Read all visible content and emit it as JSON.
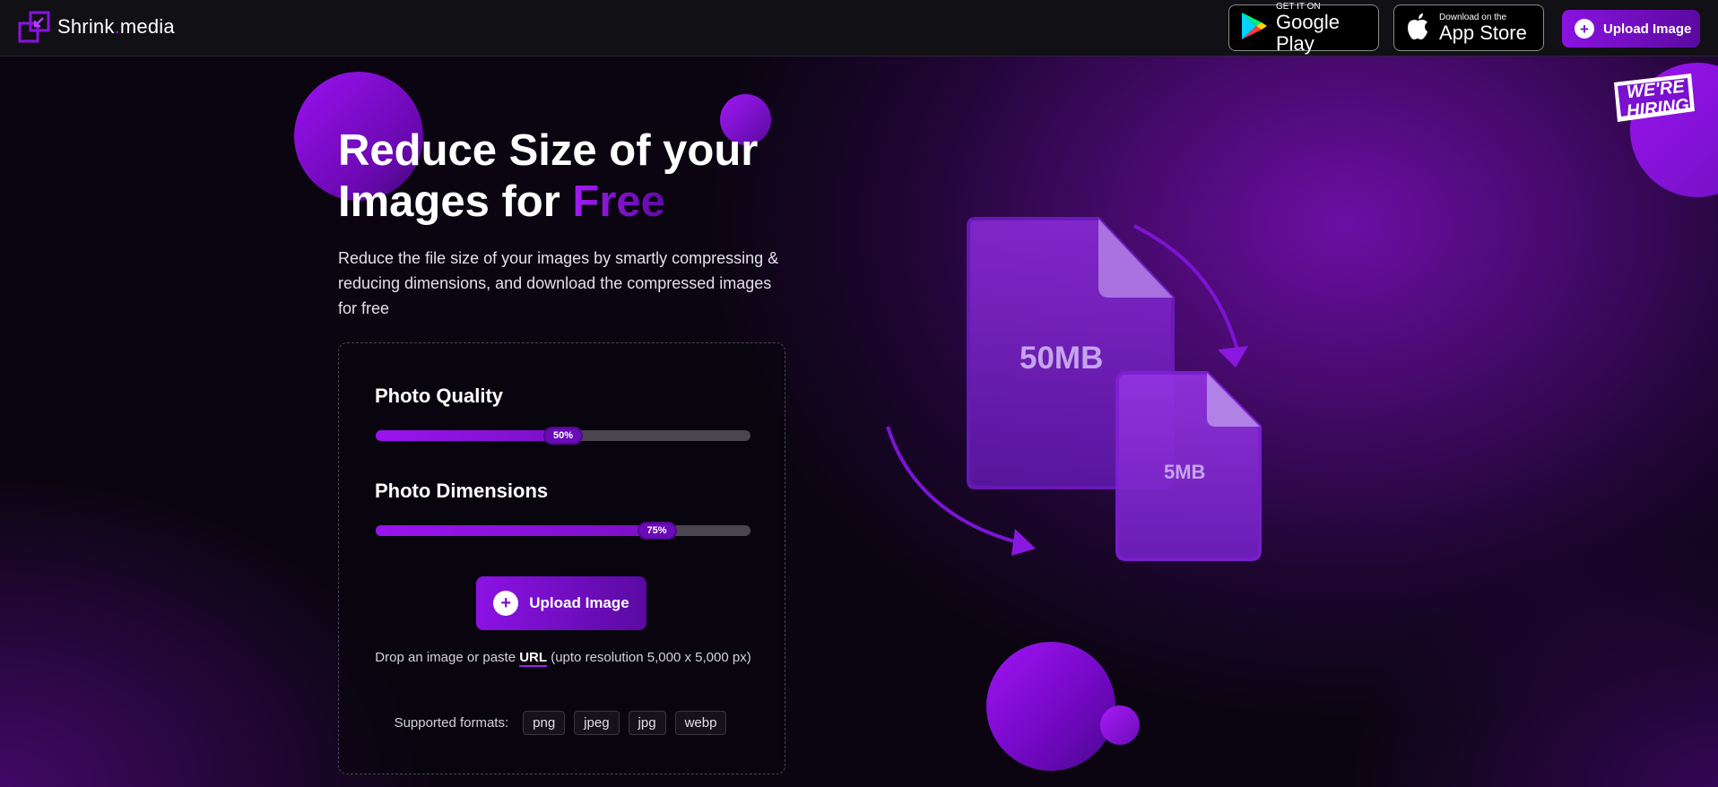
{
  "header": {
    "logo_text_a": "Shrink",
    "logo_dot": ".",
    "logo_text_b": "media",
    "google_play": {
      "small": "GET IT ON",
      "big": "Google Play"
    },
    "app_store": {
      "small": "Download on the",
      "big": "App Store"
    },
    "upload_label": "Upload Image"
  },
  "hero": {
    "title_line1": "Reduce Size of your",
    "title_line2_prefix": "Images for ",
    "title_highlight": "Free",
    "subtitle": "Reduce the file size of your images by smartly compressing & reducing dimensions, and download the compressed images for free"
  },
  "card": {
    "quality": {
      "label": "Photo Quality",
      "value_text": "50%",
      "value": 0.5
    },
    "dimensions": {
      "label": "Photo Dimensions",
      "value_text": "75%",
      "value": 0.75
    },
    "upload_label": "Upload Image",
    "drop_prefix": "Drop an image or paste ",
    "drop_url": "URL",
    "drop_suffix": " (upto resolution 5,000 x 5,000 px)",
    "formats_label": "Supported formats:",
    "formats": [
      "png",
      "jpeg",
      "jpg",
      "webp"
    ]
  },
  "illustration": {
    "big_file": "50MB",
    "small_file": "5MB"
  },
  "badge": {
    "line1": "WE'RE",
    "line2": "HIRING"
  },
  "colors": {
    "accent": "#8a12e0",
    "accent_dark": "#5a0aa0",
    "background": "#0a0510"
  }
}
